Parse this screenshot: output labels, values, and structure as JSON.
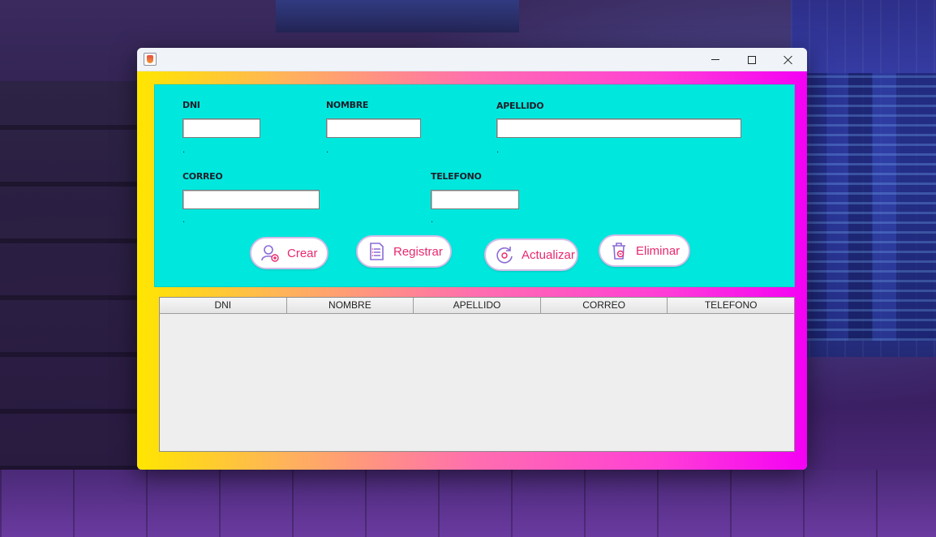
{
  "window": {
    "title": "",
    "controls": {
      "minimize": "minimize",
      "maximize": "maximize",
      "close": "close"
    }
  },
  "form": {
    "fields": {
      "dni": {
        "label": "DNI",
        "value": "",
        "hint": "."
      },
      "nombre": {
        "label": "NOMBRE",
        "value": "",
        "hint": "."
      },
      "apellido": {
        "label": "APELLIDO",
        "value": "",
        "hint": "."
      },
      "correo": {
        "label": "CORREO",
        "value": "",
        "hint": "."
      },
      "telefono": {
        "label": "TELEFONO",
        "value": "",
        "hint": "."
      }
    }
  },
  "actions": {
    "crear": {
      "label": "Crear",
      "icon": "user-add-icon"
    },
    "registrar": {
      "label": "Registrar",
      "icon": "document-list-icon"
    },
    "actualizar": {
      "label": "Actualizar",
      "icon": "refresh-icon"
    },
    "eliminar": {
      "label": "Eliminar",
      "icon": "trash-icon"
    }
  },
  "table": {
    "columns": [
      "DNI",
      "NOMBRE",
      "APELLIDO",
      "CORREO",
      "TELEFONO"
    ],
    "rows": []
  },
  "colors": {
    "form_panel": "#00e8de",
    "button_text": "#e8286f",
    "button_border": "#d3bde8",
    "gradient_start": "#ffe600",
    "gradient_end": "#f400f4"
  }
}
